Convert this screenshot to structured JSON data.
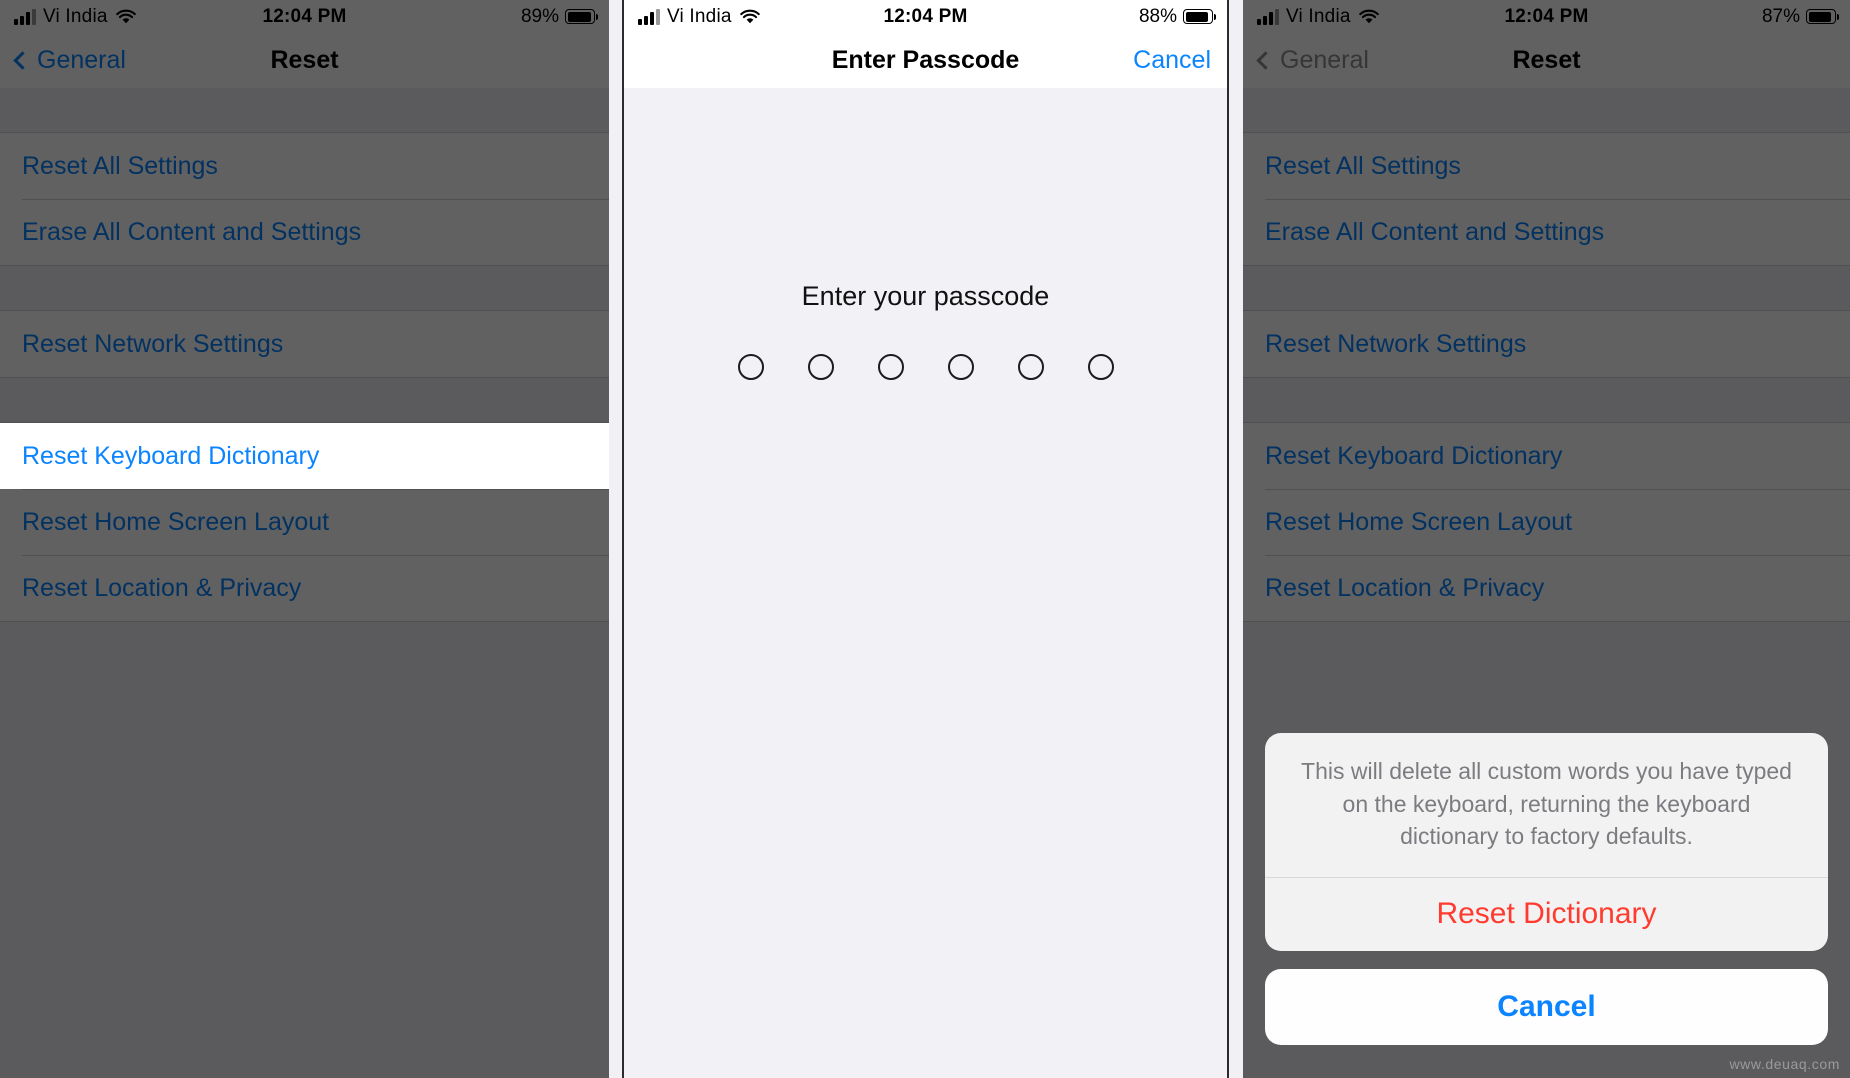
{
  "panels": [
    {
      "id": "panel-reset-list",
      "status": {
        "carrier": "Vi India",
        "time": "12:04 PM",
        "battery": "89%",
        "signal_icon": "cellular-bars-icon",
        "wifi_icon": "wifi-icon",
        "battery_icon": "battery-icon"
      },
      "nav": {
        "back_label": "General",
        "title": "Reset",
        "back_icon": "chevron-left-icon"
      },
      "rows": [
        {
          "label": "Reset All Settings",
          "highlight": false
        },
        {
          "label": "Erase All Content and Settings",
          "highlight": false
        },
        {
          "label": "Reset Network Settings",
          "highlight": false
        },
        {
          "label": "Reset Keyboard Dictionary",
          "highlight": true
        },
        {
          "label": "Reset Home Screen Layout",
          "highlight": false
        },
        {
          "label": "Reset Location & Privacy",
          "highlight": false
        }
      ]
    },
    {
      "id": "panel-enter-passcode",
      "status": {
        "carrier": "Vi India",
        "time": "12:04 PM",
        "battery": "88%",
        "signal_icon": "cellular-bars-icon",
        "wifi_icon": "wifi-icon",
        "battery_icon": "battery-icon"
      },
      "nav": {
        "title": "Enter Passcode",
        "cancel_label": "Cancel"
      },
      "prompt": "Enter your passcode",
      "passcode_length": 6,
      "passcode_filled": 0
    },
    {
      "id": "panel-reset-confirm",
      "status": {
        "carrier": "Vi India",
        "time": "12:04 PM",
        "battery": "87%",
        "signal_icon": "cellular-bars-icon",
        "wifi_icon": "wifi-icon",
        "battery_icon": "battery-icon"
      },
      "nav": {
        "back_label": "General",
        "title": "Reset",
        "back_icon": "chevron-left-icon"
      },
      "rows": [
        {
          "label": "Reset All Settings",
          "highlight": false
        },
        {
          "label": "Erase All Content and Settings",
          "highlight": false
        },
        {
          "label": "Reset Network Settings",
          "highlight": false
        },
        {
          "label": "Reset Keyboard Dictionary",
          "highlight": false
        },
        {
          "label": "Reset Home Screen Layout",
          "highlight": false
        },
        {
          "label": "Reset Location & Privacy",
          "highlight": false
        }
      ],
      "action_sheet": {
        "message": "This will delete all custom words you have typed on the keyboard, returning the keyboard dictionary to factory defaults.",
        "destructive_label": "Reset Dictionary",
        "cancel_label": "Cancel"
      }
    }
  ],
  "colors": {
    "tint_blue": "#0a84ff",
    "destructive_red": "#ff3b30",
    "list_bg": "#efeff4",
    "passcode_bg": "#f1f1f6",
    "sheet_bg": "#f3f2f3",
    "muted_text": "#7c7c80"
  },
  "watermark": "www.deuaq.com"
}
